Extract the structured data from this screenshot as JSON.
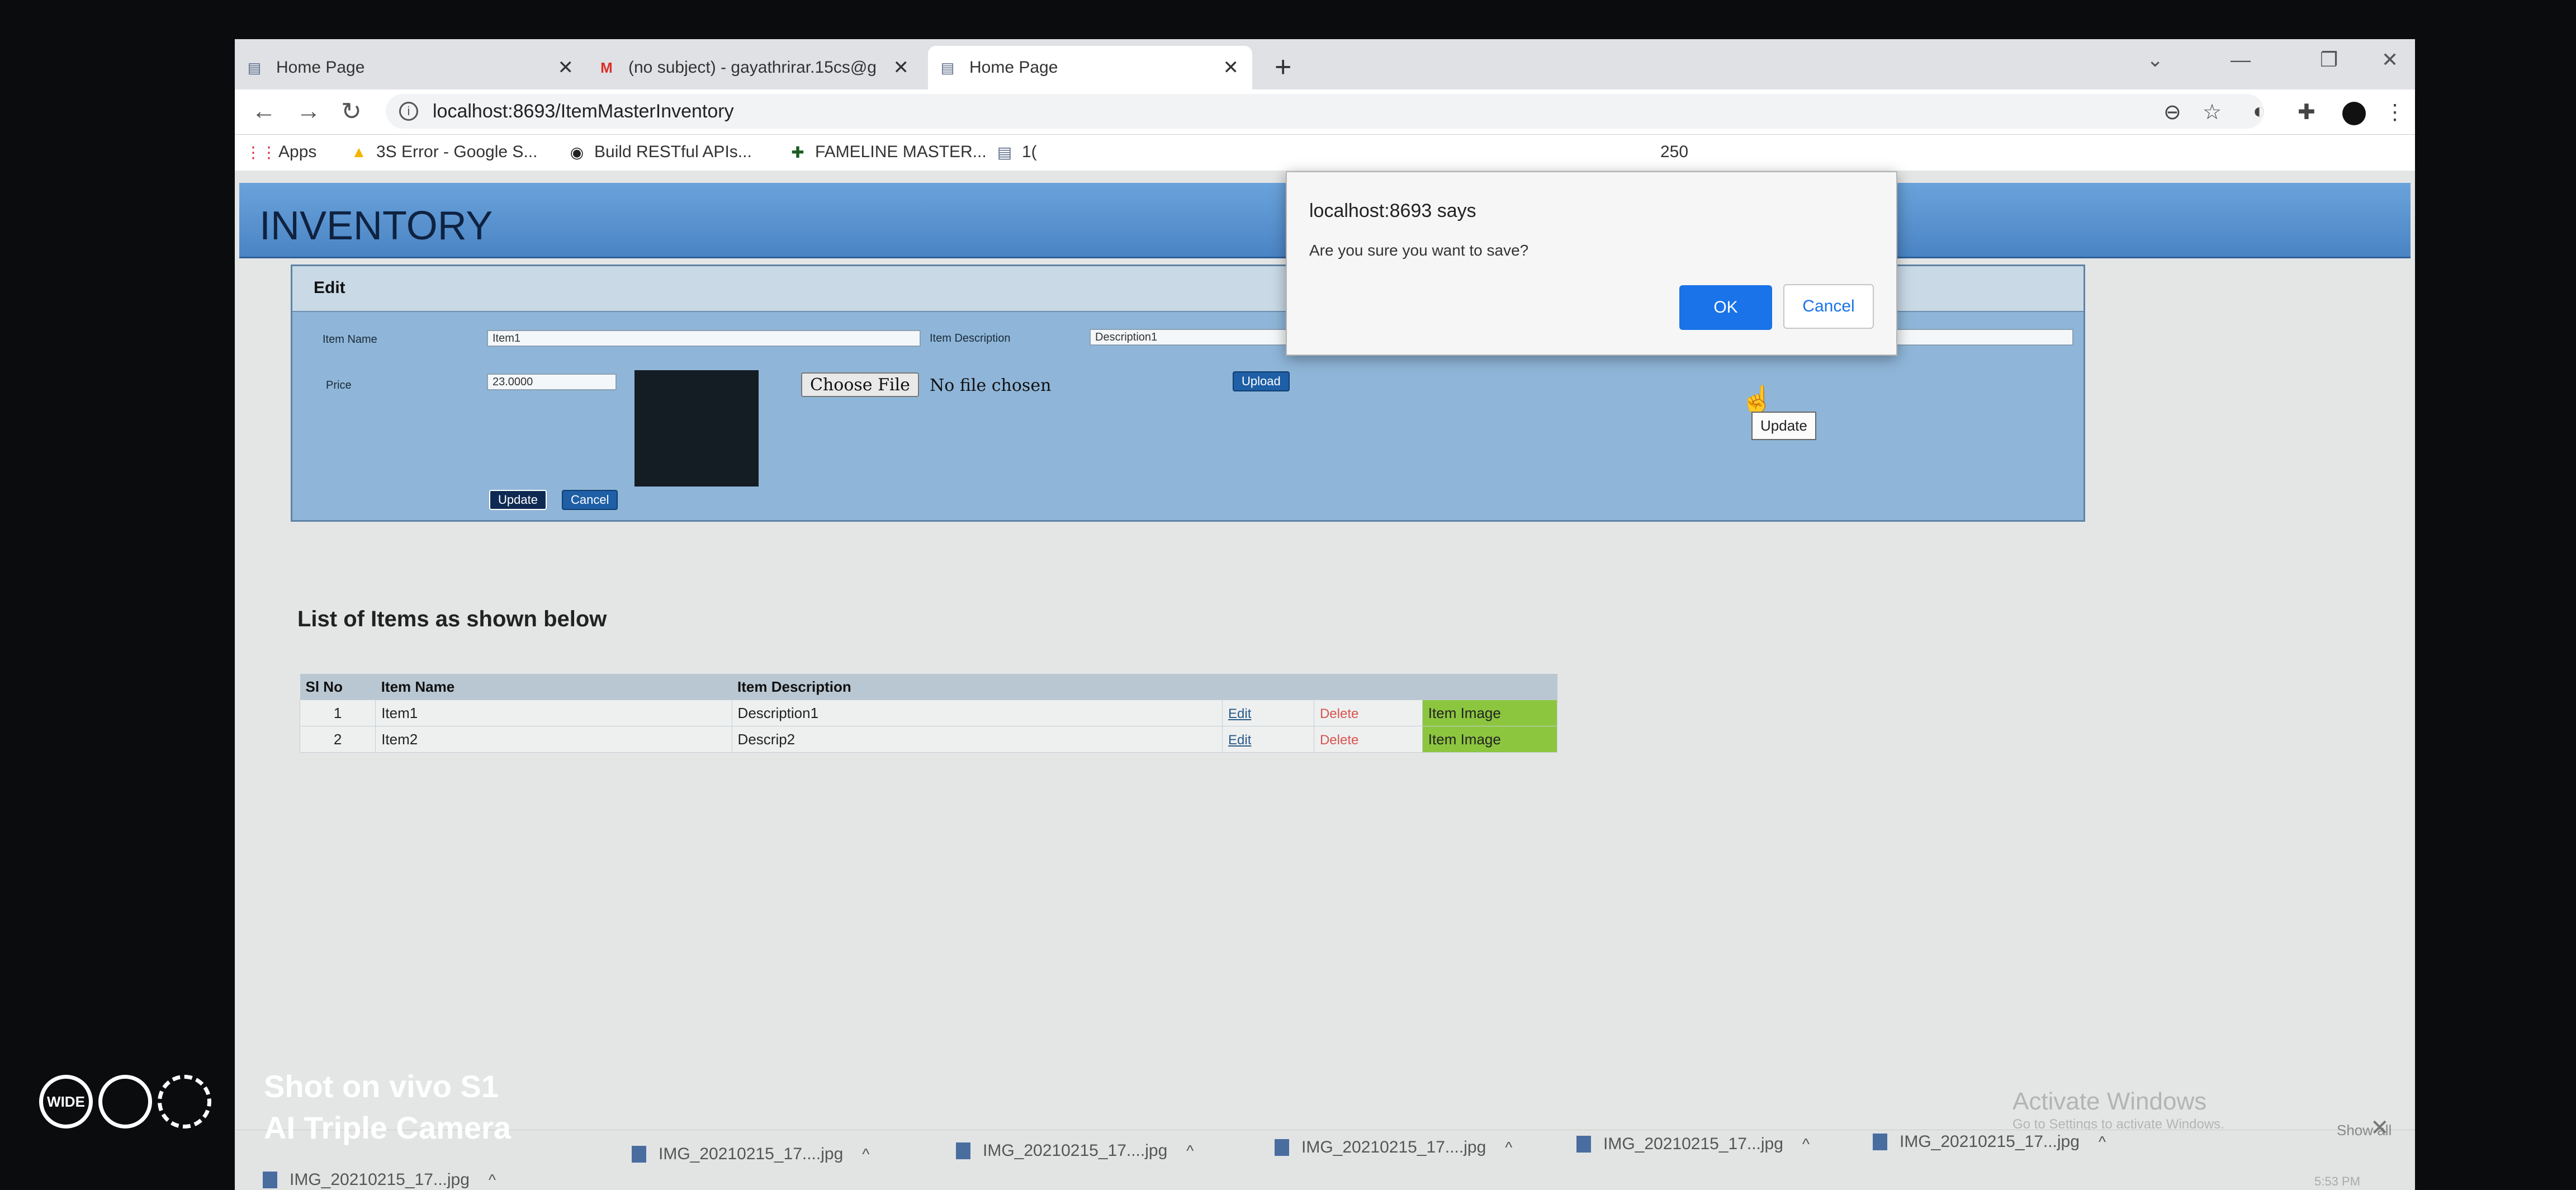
{
  "browser": {
    "tabs": [
      {
        "title": "Home Page",
        "icon": "page-icon",
        "active": false
      },
      {
        "title": "(no subject) - gayathrirar.15cs@g",
        "icon": "gmail-icon",
        "active": false
      },
      {
        "title": "Home Page",
        "icon": "page-icon",
        "active": true
      }
    ],
    "new_tab_label": "+",
    "url": "localhost:8693/ItemMasterInventory",
    "bookmarks": [
      {
        "label": "Apps",
        "icon": "apps-grid-icon"
      },
      {
        "label": "3S Error - Google S...",
        "icon": "google-drive-icon"
      },
      {
        "label": "Build RESTful APIs...",
        "icon": "globe-icon"
      },
      {
        "label": "FAMELINE MASTER...",
        "icon": "bookmark-icon"
      },
      {
        "label": "1(",
        "icon": "page-icon"
      },
      {
        "label": "250",
        "icon": ""
      }
    ]
  },
  "page": {
    "banner_title": "INVENTORY",
    "edit_panel": {
      "title": "Edit",
      "item_name_label": "Item Name",
      "item_name_value": "Item1",
      "item_description_label": "Item Description",
      "item_description_value": "Description1",
      "price_label": "Price",
      "price_value": "23.0000",
      "choose_file_label": "Choose File",
      "no_file_text": "No file chosen",
      "upload_label": "Upload",
      "update_label": "Update",
      "cancel_label": "Cancel",
      "tooltip": "Update"
    },
    "list_heading": "List of Items as shown below",
    "table": {
      "headers": [
        "Sl No",
        "Item Name",
        "Item Description"
      ],
      "rows": [
        {
          "sl": "1",
          "name": "Item1",
          "description": "Description1",
          "edit": "Edit",
          "delete": "Delete",
          "extra": "Item Image"
        },
        {
          "sl": "2",
          "name": "Item2",
          "description": "Descrip2",
          "edit": "Edit",
          "delete": "Delete",
          "extra": "Item Image"
        }
      ]
    }
  },
  "dialog": {
    "title": "localhost:8693 says",
    "message": "Are you sure you want to save?",
    "ok_label": "OK",
    "cancel_label": "Cancel"
  },
  "windows": {
    "activate_title": "Activate Windows",
    "activate_sub": "Go to Settings to activate Windows."
  },
  "downloads": {
    "items": [
      "IMG_20210215_17...jpg",
      "IMG_20210215_17....jpg",
      "IMG_20210215_17....jpg",
      "IMG_20210215_17....jpg",
      "IMG_20210215_17...jpg",
      "IMG_20210215_17...jpg"
    ],
    "show_all": "Show all",
    "clock": "5:53 PM"
  },
  "watermark": {
    "line1": "Shot on vivo S1",
    "line2": "AI Triple Camera",
    "logo_text": "WIDE"
  },
  "colors": {
    "banner": "#4a84c4",
    "panel": "#8fb6d8",
    "ok_button": "#1a73e8",
    "green_cell": "#8cc63f"
  }
}
